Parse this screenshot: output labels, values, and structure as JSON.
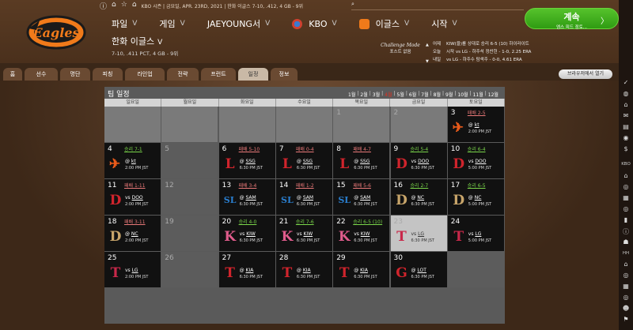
{
  "topbar": {
    "league_info": "KBO 시즌 | 금요일, APR. 23RD, 2021 | 한화 이글스 7-10, .412, 4 GB - 9위",
    "icons": [
      "info-icon",
      "pin-icon",
      "star-icon",
      "home-icon"
    ],
    "search_icon": "search-icon"
  },
  "nav": {
    "items": [
      {
        "label": "파일",
        "chev": "V"
      },
      {
        "label": "게임",
        "chev": "V"
      },
      {
        "label": "JAEYOUNG서",
        "chev": "V"
      },
      {
        "label": "KBO",
        "chev": "V"
      },
      {
        "label": "이글스",
        "chev": "V"
      },
      {
        "label": "시작",
        "chev": "V"
      }
    ]
  },
  "team": {
    "title": "한화 이글스",
    "chev": "V",
    "record": "7-10, .411 PCT, 4 GB - 9위"
  },
  "challenge": {
    "line1": "Challenge Mode",
    "line2": "포스트 없음"
  },
  "games": {
    "rows": [
      {
        "label": "어제",
        "text": "KIW(을)를 상대로 승리 6-5 (10)    하이라이트"
      },
      {
        "label": "오늘",
        "text": "시작 vs LG - 하주석 정찬헌 - 1-0, 2.25 ERA"
      },
      {
        "label": "내일",
        "text": "vs LG - 하주수 탐색주 - 0-0, 4.61 ERA"
      }
    ]
  },
  "continue_button": {
    "label": "계속",
    "sub": "엠스 피드 점토...",
    "arrow": "〉"
  },
  "tabs": [
    {
      "label": "홈"
    },
    {
      "label": "선수"
    },
    {
      "label": "명단"
    },
    {
      "label": "피칭"
    },
    {
      "label": "라인업"
    },
    {
      "label": "전략"
    },
    {
      "label": "프런트"
    },
    {
      "label": "일정"
    },
    {
      "label": "정보"
    }
  ],
  "active_tab": "일정",
  "browser_button": "브라우저에서 열기",
  "calendar": {
    "title": "팀 일정",
    "months": [
      "1월",
      "2월",
      "3월",
      "4월",
      "5월",
      "6월",
      "7월",
      "8월",
      "9월",
      "10월",
      "11월",
      "12월"
    ],
    "selected_month": "4월",
    "weekdays": [
      "일요일",
      "월요일",
      "화요일",
      "수요일",
      "목요일",
      "금요일",
      "토요일"
    ],
    "cells": [
      {
        "day": "",
        "kind": "empty"
      },
      {
        "day": "",
        "kind": "empty"
      },
      {
        "day": "",
        "kind": "empty"
      },
      {
        "day": "",
        "kind": "empty"
      },
      {
        "day": "1",
        "kind": "empty"
      },
      {
        "day": "2",
        "kind": "empty"
      },
      {
        "day": "3",
        "kind": "game",
        "result": "패배 2-5",
        "res": "loss",
        "opp": "@ kt",
        "time": "2:00 PM JST",
        "emblem": "hanwha"
      },
      {
        "day": "4",
        "kind": "game",
        "result": "승리 7-1",
        "res": "win",
        "opp": "@ kt",
        "time": "2:00 PM JST",
        "emblem": "hanwha"
      },
      {
        "day": "5",
        "kind": "blank"
      },
      {
        "day": "6",
        "kind": "game",
        "result": "패배 5-10",
        "res": "loss",
        "opp": "@ SSG",
        "time": "6:30 PM JST",
        "emblem": "ssg"
      },
      {
        "day": "7",
        "kind": "game",
        "result": "패배 0-4",
        "res": "loss",
        "opp": "@ SSG",
        "time": "6:30 PM JST",
        "emblem": "ssg"
      },
      {
        "day": "8",
        "kind": "game",
        "result": "패배 4-7",
        "res": "loss",
        "opp": "@ SSG",
        "time": "6:30 PM JST",
        "emblem": "ssg"
      },
      {
        "day": "9",
        "kind": "game",
        "result": "승리 5-4",
        "res": "win",
        "opp": "vs DOO",
        "time": "6:30 PM JST",
        "emblem": "doo"
      },
      {
        "day": "10",
        "kind": "game",
        "result": "승리 6-4",
        "res": "win",
        "opp": "vs DOO",
        "time": "5:00 PM JST",
        "emblem": "doo"
      },
      {
        "day": "11",
        "kind": "game",
        "result": "패배 1-11",
        "res": "loss",
        "opp": "vs DOO",
        "time": "2:00 PM JST",
        "emblem": "doo"
      },
      {
        "day": "12",
        "kind": "blank"
      },
      {
        "day": "13",
        "kind": "game",
        "result": "패배 3-4",
        "res": "loss",
        "opp": "@ SAM",
        "time": "6:30 PM JST",
        "emblem": "sam"
      },
      {
        "day": "14",
        "kind": "game",
        "result": "패배 1-2",
        "res": "loss",
        "opp": "@ SAM",
        "time": "6:30 PM JST",
        "emblem": "sam"
      },
      {
        "day": "15",
        "kind": "game",
        "result": "패배 5-6",
        "res": "loss",
        "opp": "@ SAM",
        "time": "6:30 PM JST",
        "emblem": "sam"
      },
      {
        "day": "16",
        "kind": "game",
        "result": "승리 2-7",
        "res": "win",
        "opp": "@ NC",
        "time": "6:30 PM JST",
        "emblem": "nc"
      },
      {
        "day": "17",
        "kind": "game",
        "result": "승리 6-5",
        "res": "win",
        "opp": "@ NC",
        "time": "5:00 PM JST",
        "emblem": "nc"
      },
      {
        "day": "18",
        "kind": "game",
        "result": "패배 3-11",
        "res": "loss",
        "opp": "@ NC",
        "time": "2:00 PM JST",
        "emblem": "nc"
      },
      {
        "day": "19",
        "kind": "blank"
      },
      {
        "day": "20",
        "kind": "game",
        "result": "승리 4-0",
        "res": "win",
        "opp": "vs KIW",
        "time": "6:30 PM JST",
        "emblem": "kiw"
      },
      {
        "day": "21",
        "kind": "game",
        "result": "승리 7-6",
        "res": "win",
        "opp": "vs KIW",
        "time": "6:30 PM JST",
        "emblem": "kiw"
      },
      {
        "day": "22",
        "kind": "game",
        "result": "승리 6-5 (10)",
        "res": "win",
        "opp": "vs KIW",
        "time": "6:30 PM JST",
        "emblem": "kiw"
      },
      {
        "day": "23",
        "kind": "today",
        "result": "",
        "opp": "vs LG",
        "time": "6:30 PM JST",
        "emblem": "lg"
      },
      {
        "day": "24",
        "kind": "game",
        "result": "",
        "opp": "vs LG",
        "time": "5:00 PM JST",
        "emblem": "lg"
      },
      {
        "day": "25",
        "kind": "game",
        "result": "",
        "opp": "vs LG",
        "time": "2:00 PM JST",
        "emblem": "lg"
      },
      {
        "day": "26",
        "kind": "blank"
      },
      {
        "day": "27",
        "kind": "game",
        "result": "",
        "opp": "@ KIA",
        "time": "6:30 PM JST",
        "emblem": "kia"
      },
      {
        "day": "28",
        "kind": "game",
        "result": "",
        "opp": "@ KIA",
        "time": "6:30 PM JST",
        "emblem": "kia"
      },
      {
        "day": "29",
        "kind": "game",
        "result": "",
        "opp": "@ KIA",
        "time": "6:30 PM JST",
        "emblem": "kia"
      },
      {
        "day": "30",
        "kind": "game",
        "result": "",
        "opp": "@ LOT",
        "time": "6:30 PM JST",
        "emblem": "lot"
      },
      {
        "day": "",
        "kind": "blank"
      }
    ]
  },
  "emblems": {
    "hanwha": {
      "glyph": "✈",
      "color": "#e85a1a",
      "icon": "hanwha-logo-icon"
    },
    "ssg": {
      "glyph": "L",
      "color": "#d0242c",
      "icon": "ssg-logo-icon"
    },
    "doo": {
      "glyph": "D",
      "color": "#d0242c",
      "icon": "doosan-logo-icon"
    },
    "sam": {
      "glyph": "SL",
      "color": "#2a7fd0",
      "icon": "samsung-logo-icon"
    },
    "nc": {
      "glyph": "D",
      "color": "#c8a56a",
      "icon": "nc-logo-icon"
    },
    "kiw": {
      "glyph": "K",
      "color": "#e05c8c",
      "icon": "kiwoom-logo-icon"
    },
    "lg": {
      "glyph": "T",
      "color": "#c8284a",
      "icon": "lg-logo-icon"
    },
    "kia": {
      "glyph": "T",
      "color": "#d0242c",
      "icon": "kia-logo-icon"
    },
    "lot": {
      "glyph": "G",
      "color": "#d0242c",
      "icon": "lotte-logo-icon"
    }
  },
  "sidebar": {
    "top_icons": [
      "check-icon",
      "globe-icon",
      "home-icon",
      "mail-icon",
      "clipboard-icon",
      "eye-icon",
      "dollar-icon"
    ],
    "kbo_label": "KBO",
    "kbo_icons": [
      "home-icon",
      "target-icon",
      "doc-icon",
      "target-icon",
      "chart-icon",
      "info-icon",
      "team-icon"
    ],
    "hh_label": "HH",
    "hh_icons": [
      "home-icon",
      "target-icon",
      "doc-icon",
      "target-icon",
      "people-icon",
      "flag-icon"
    ]
  }
}
